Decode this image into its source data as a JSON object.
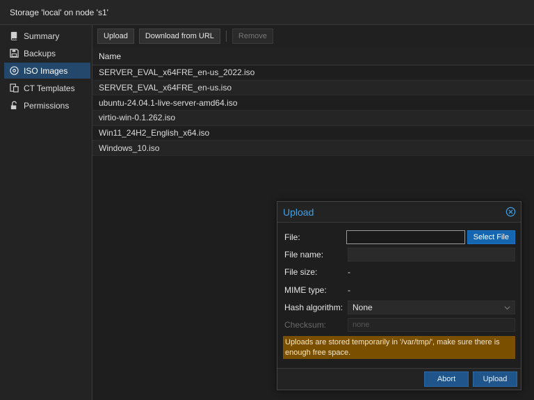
{
  "window": {
    "title": "Storage 'local' on node 's1'"
  },
  "sidebar": {
    "items": [
      {
        "label": "Summary",
        "icon": "book-icon",
        "active": false
      },
      {
        "label": "Backups",
        "icon": "floppy-icon",
        "active": false
      },
      {
        "label": "ISO Images",
        "icon": "disc-icon",
        "active": true
      },
      {
        "label": "CT Templates",
        "icon": "template-icon",
        "active": false
      },
      {
        "label": "Permissions",
        "icon": "unlock-icon",
        "active": false
      }
    ]
  },
  "toolbar": {
    "upload_label": "Upload",
    "download_label": "Download from URL",
    "remove_label": "Remove"
  },
  "grid": {
    "column_name": "Name",
    "rows": [
      "SERVER_EVAL_x64FRE_en-us_2022.iso",
      "SERVER_EVAL_x64FRE_en-us.iso",
      "ubuntu-24.04.1-live-server-amd64.iso",
      "virtio-win-0.1.262.iso",
      "Win11_24H2_English_x64.iso",
      "Windows_10.iso"
    ]
  },
  "dialog": {
    "title": "Upload",
    "file_label": "File:",
    "file_value": "",
    "select_file_label": "Select File",
    "file_name_label": "File name:",
    "file_name_value": "",
    "file_size_label": "File size:",
    "file_size_value": "-",
    "mime_label": "MIME type:",
    "mime_value": "-",
    "hash_label": "Hash algorithm:",
    "hash_value": "None",
    "checksum_label": "Checksum:",
    "checksum_placeholder": "none",
    "warning": "Uploads are stored temporarily in '/var/tmp/', make sure there is enough free space.",
    "abort_label": "Abort",
    "upload_label": "Upload"
  },
  "colors": {
    "accent": "#3fa0e6",
    "selected_nav": "#23486b",
    "primary_button": "#1565b0",
    "warning_bg": "#7a4f00"
  }
}
